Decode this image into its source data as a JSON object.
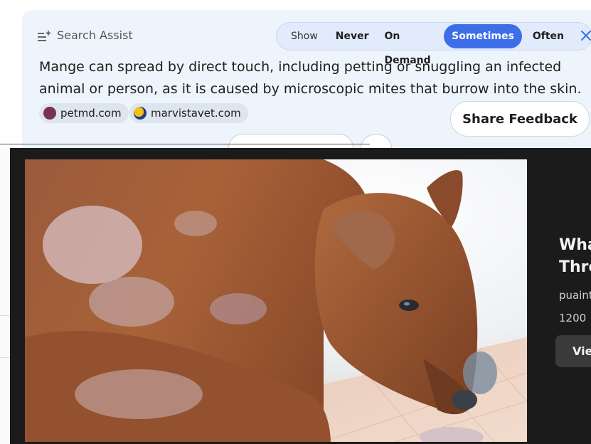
{
  "assist": {
    "title": "Search Assist",
    "frequency": {
      "show_label": "Show",
      "options": [
        "Never",
        "On Demand",
        "Sometimes",
        "Often"
      ],
      "selected": "Sometimes"
    },
    "answer": "Mange can spread by direct touch, including petting or snuggling an infected animal or person, as it is caused by microscopic mites that burrow into the skin.",
    "sources": [
      "petmd.com",
      "marvistavet.com"
    ],
    "feedback_label": "Share Feedback",
    "icons": {
      "title": "sparkle-list-icon",
      "close": "close-icon"
    },
    "accent": "#3c6ee8"
  },
  "viewer": {
    "title_fragment": "Wha Thre",
    "source_fragment": "puaint",
    "size_fragment": "1200 ×",
    "view_button_fragment": "Vie",
    "image_subject": "brown dog with mange lying on tiled floor"
  }
}
